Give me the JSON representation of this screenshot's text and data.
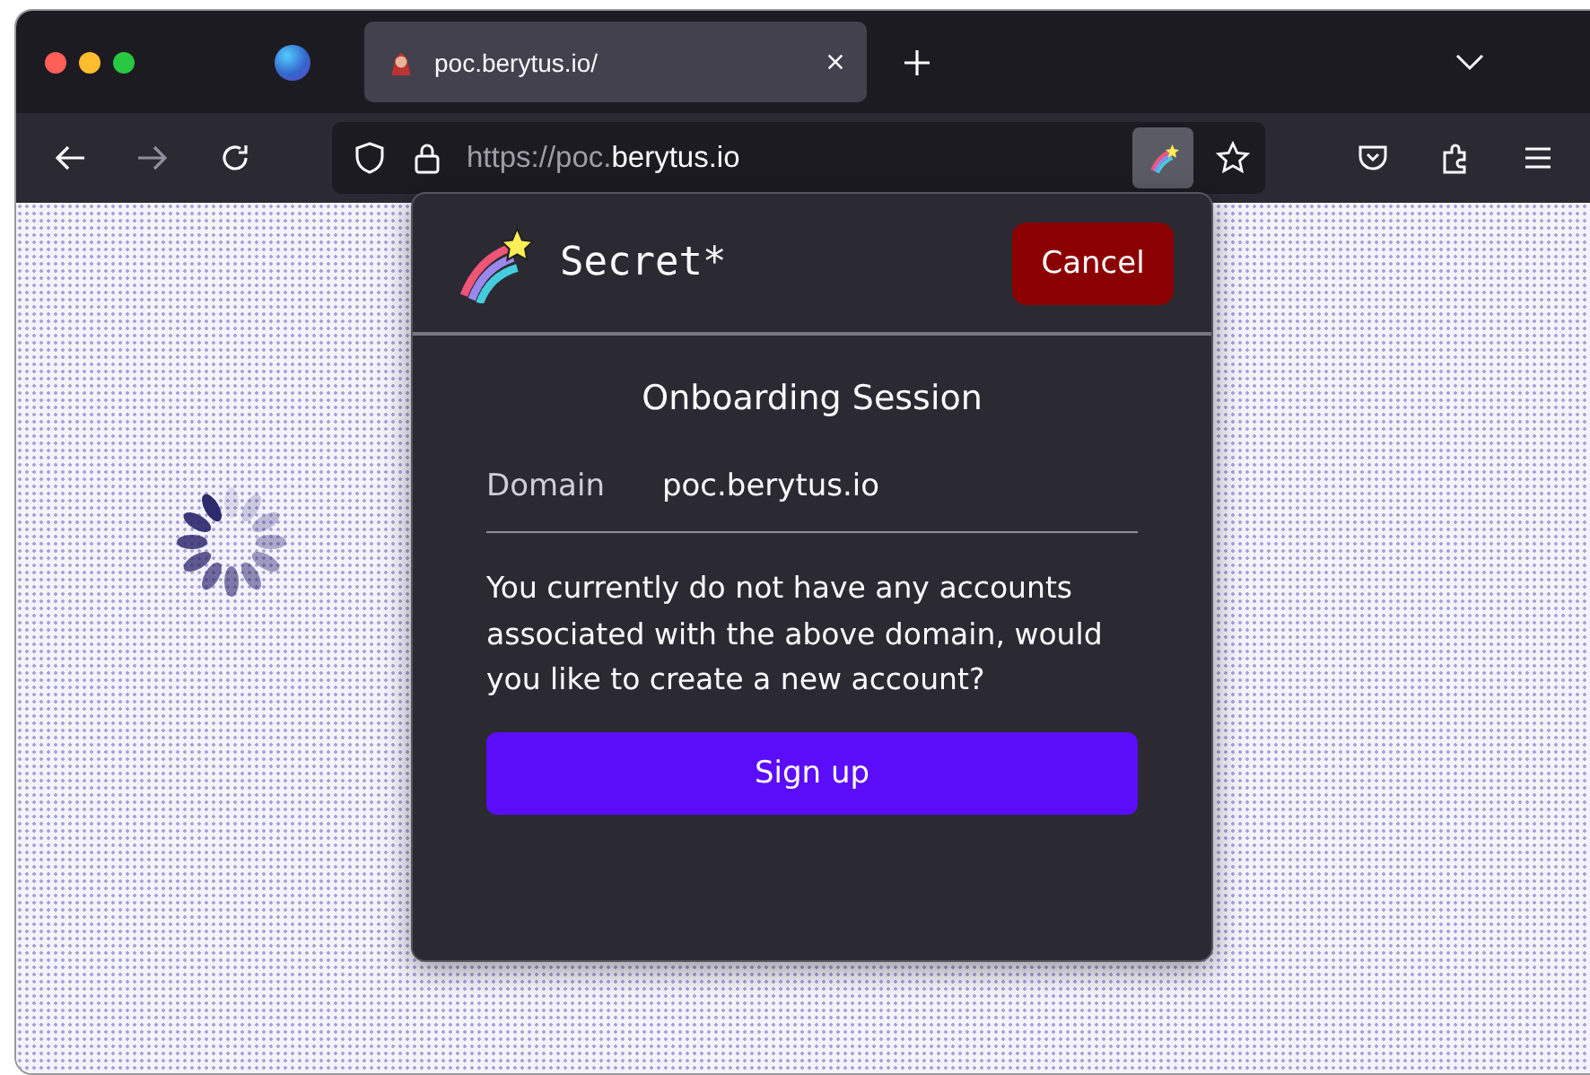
{
  "tabs": [
    {
      "title": "poc.berytus.io/",
      "selected": true
    }
  ],
  "address_bar": {
    "url_start": "https://poc.",
    "url_host": "berytus.io"
  },
  "toolbar": {
    "extension_active": true
  },
  "popup": {
    "app_name": "Secret*",
    "cancel_button": "Cancel",
    "heading": "Onboarding Session",
    "fields": [
      {
        "label": "Domain",
        "value": "poc.berytus.io"
      }
    ],
    "message": "You currently do not have any accounts associated with the above domain, would you like to create a new account?",
    "sign_up_button": "Sign up"
  }
}
